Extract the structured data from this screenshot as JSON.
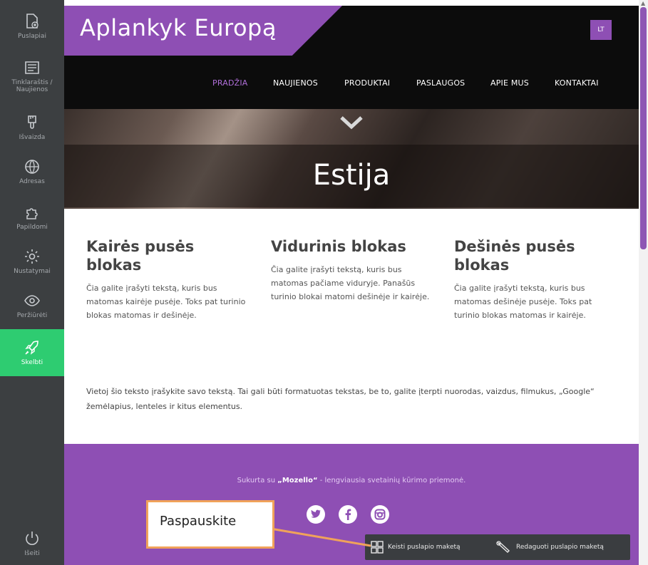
{
  "sidebar": {
    "items": [
      {
        "label": "Puslapiai",
        "icon": "page-add-icon"
      },
      {
        "label": "Tinklaraštis / Naujienos",
        "icon": "newspaper-icon"
      },
      {
        "label": "Išvaizda",
        "icon": "paint-brush-icon"
      },
      {
        "label": "Adresas",
        "icon": "globe-icon"
      },
      {
        "label": "Papildomi",
        "icon": "puzzle-icon"
      },
      {
        "label": "Nustatymai",
        "icon": "gear-icon"
      },
      {
        "label": "Peržiūrėti",
        "icon": "eye-icon"
      },
      {
        "label": "Skelbti",
        "icon": "rocket-icon"
      }
    ],
    "logout_label": "Išeiti"
  },
  "site": {
    "brand": "Aplankyk Europą",
    "language": "LT",
    "nav": [
      "PRADŽIA",
      "NAUJIENOS",
      "PRODUKTAI",
      "PASLAUGOS",
      "APIE MUS",
      "KONTAKTAI"
    ],
    "hero_title": "Estija",
    "columns": [
      {
        "title": "Kairės pusės blokas",
        "text": "Čia galite įrašyti tekstą, kuris bus matomas kairėje pusėje. Toks pat turinio blokas matomas ir dešinėje."
      },
      {
        "title": "Vidurinis blokas",
        "text": "Čia galite įrašyti tekstą, kuris bus matomas pačiame viduryje. Panašūs turinio blokai matomi dešinėje ir kairėje."
      },
      {
        "title": "Dešinės pusės blokas",
        "text": "Čia galite įrašyti tekstą, kuris bus matomas dešinėje pusėje. Toks pat turinio blokas matomas ir kairėje."
      }
    ],
    "body_text": "Vietoj šio teksto įrašykite savo tekstą. Tai gali būti formatuotas tekstas, be to, galite įterpti nuorodas, vaizdus, filmukus, „Google“ žemėlapius, lenteles ir kitus elementus.",
    "footer": {
      "credit_prefix": "Sukurta su ",
      "credit_brand": "„Mozello“",
      "credit_suffix": " - lengviausia svetainių kūrimo priemonė.",
      "social_icons": [
        "twitter-icon",
        "facebook-icon",
        "instagram-icon"
      ]
    }
  },
  "toolbar": {
    "change_layout_label": "Keisti puslapio maketą",
    "edit_layout_label": "Redaguoti puslapio maketą"
  },
  "callout": {
    "text": "Paspauskite"
  },
  "colors": {
    "accent": "#8e4fb4",
    "sidebar": "#3c3f41",
    "publish": "#2ecc71",
    "callout_border": "#f0a25a"
  }
}
